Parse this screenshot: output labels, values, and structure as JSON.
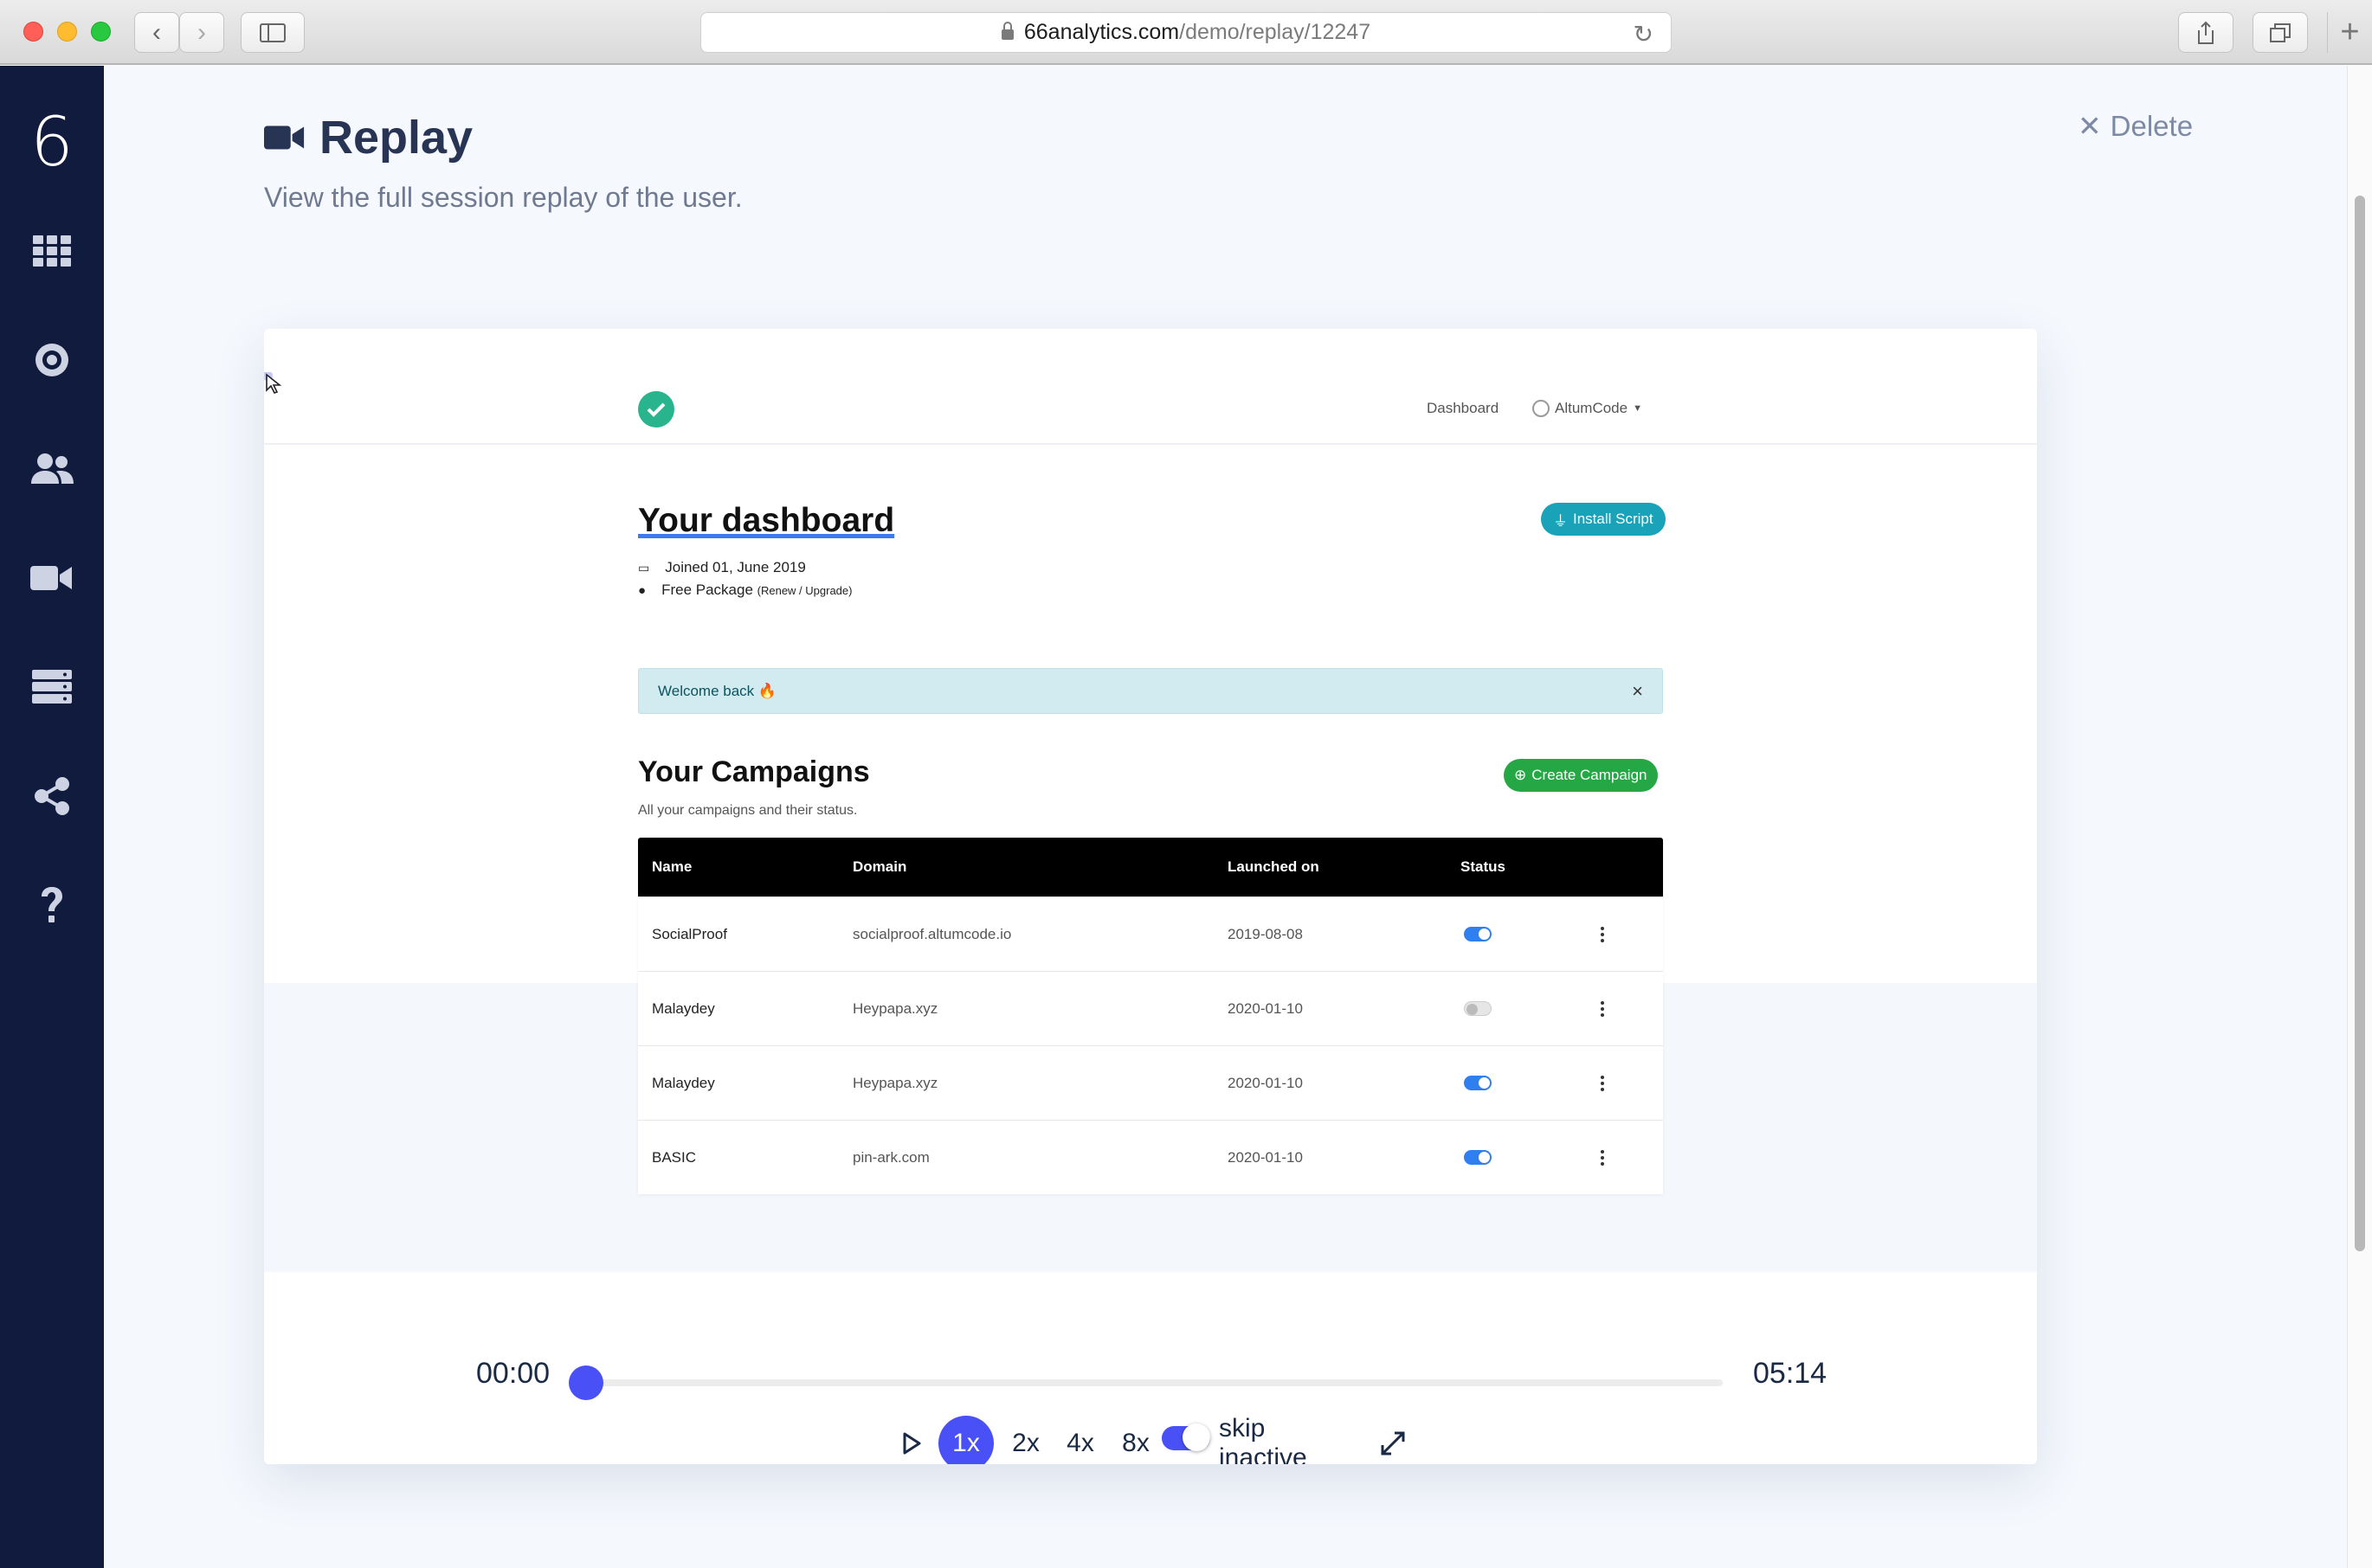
{
  "browser": {
    "url_domain": "66analytics.com",
    "url_path": "/demo/replay/12247"
  },
  "sidebar": {
    "logo": "6",
    "items": [
      {
        "icon": "grid-icon"
      },
      {
        "icon": "target-icon"
      },
      {
        "icon": "users-icon"
      },
      {
        "icon": "video-camera-icon"
      },
      {
        "icon": "server-icon"
      },
      {
        "icon": "share-icon"
      },
      {
        "icon": "question-icon"
      }
    ]
  },
  "header": {
    "title": "Replay",
    "subtitle": "View the full session replay of the user.",
    "delete_label": "Delete"
  },
  "replay": {
    "nav": {
      "dashboard_link": "Dashboard",
      "user_menu": "AltumCode"
    },
    "hero": {
      "title": "Your dashboard",
      "joined": "Joined 01, June 2019",
      "package": "Free Package",
      "package_links": "(Renew / Upgrade)",
      "install_button": "Install Script"
    },
    "alert": {
      "message": "Welcome back 🔥",
      "close": "×"
    },
    "campaigns": {
      "title": "Your Campaigns",
      "subtitle": "All your campaigns and their status.",
      "create_button": "Create Campaign",
      "columns": [
        "Name",
        "Domain",
        "Launched on",
        "Status"
      ],
      "rows": [
        {
          "name": "SocialProof",
          "domain": "socialproof.altumcode.io",
          "launched": "2019-08-08",
          "active": true
        },
        {
          "name": "Malaydey",
          "domain": "Heypapa.xyz",
          "launched": "2020-01-10",
          "active": false
        },
        {
          "name": "Malaydey",
          "domain": "Heypapa.xyz",
          "launched": "2020-01-10",
          "active": true
        },
        {
          "name": "BASIC",
          "domain": "pin-ark.com",
          "launched": "2020-01-10",
          "active": true
        }
      ]
    }
  },
  "player": {
    "current_time": "00:00",
    "total_time": "05:14",
    "progress": 0,
    "speeds": [
      "1x",
      "2x",
      "4x",
      "8x"
    ],
    "active_speed": "1x",
    "skip_inactive_label": "skip inactive",
    "skip_inactive": true,
    "colors": {
      "accent": "#4950f6"
    }
  }
}
